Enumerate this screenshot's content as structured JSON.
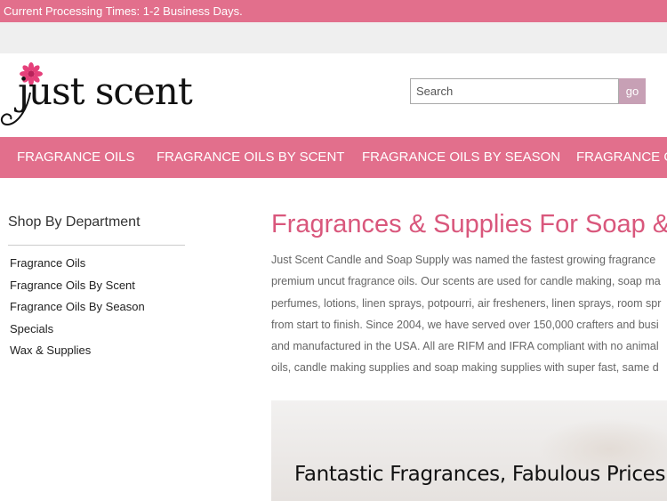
{
  "announcement": "Current Processing Times: 1-2 Business Days.",
  "logo": {
    "text": "just scent",
    "icon": "flower-icon"
  },
  "search": {
    "placeholder": "Search",
    "button_label": "go"
  },
  "nav": {
    "items": [
      {
        "label": "FRAGRANCE OILS"
      },
      {
        "label": "FRAGRANCE OILS BY SCENT"
      },
      {
        "label": "FRAGRANCE OILS BY SEASON"
      },
      {
        "label": "FRAGRANCE OILS"
      }
    ]
  },
  "sidebar": {
    "title": "Shop By Department",
    "items": [
      {
        "label": "Fragrance Oils"
      },
      {
        "label": "Fragrance Oils By Scent"
      },
      {
        "label": "Fragrance Oils By Season"
      },
      {
        "label": "Specials"
      },
      {
        "label": "Wax & Supplies"
      }
    ]
  },
  "main": {
    "title": "Fragrances & Supplies For Soap &",
    "intro_lines": [
      "Just Scent Candle and Soap Supply was named the fastest growing fragrance",
      "premium uncut fragrance oils. Our scents are used for candle making, soap ma",
      "perfumes, lotions, linen sprays, potpourri, air fresheners, linen sprays, room spr",
      "from start to finish. Since 2004, we have served over 150,000 crafters and busi",
      "and manufactured in the USA. All are RIFM and IFRA compliant with no animal",
      "oils, candle making supplies and soap making supplies with super fast, same d"
    ],
    "banner_text": "Fantastic Fragrances, Fabulous Prices"
  },
  "colors": {
    "brand_pink": "#e26f8c",
    "title_pink": "#d9577c",
    "search_button": "#c7a0b5"
  }
}
